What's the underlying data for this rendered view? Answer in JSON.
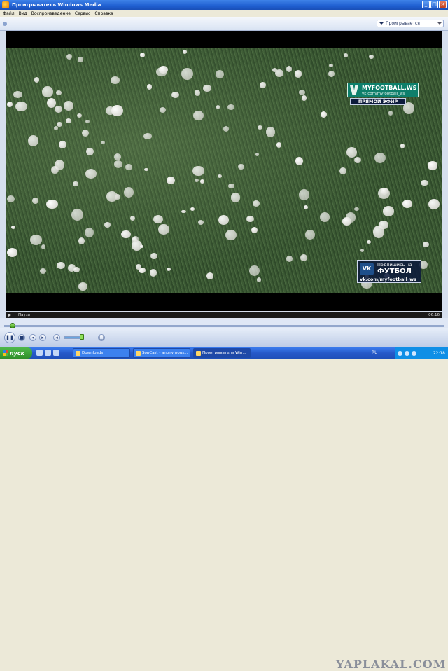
{
  "window": {
    "title": "Проигрыватель Windows Media",
    "controls": {
      "minimize": "_",
      "maximize": "□",
      "close": "×"
    }
  },
  "menu": [
    "Файл",
    "Вид",
    "Воспроизведение",
    "Сервис",
    "Справка"
  ],
  "now_playing": {
    "label": "Проигрывается"
  },
  "overlay": {
    "brand": "MYFOOTBALL.WS",
    "brand_url": "vk.com/myfootball_ws",
    "live_badge": "ПРЯМОЙ ЭФИР",
    "vk_badge": "VK",
    "vk_line1": "Подпишись на",
    "vk_line2": "ФУТБОЛ",
    "vk_line3": "vk.com/myfootball_ws"
  },
  "status": {
    "text": "Пауза",
    "time": "06:16"
  },
  "seek": {
    "progress_percent": 2.5
  },
  "volume": {
    "level_percent": 85
  },
  "watermark": "YAPLAKAL.COM",
  "taskbar": {
    "start_label": "пуск",
    "tasks": [
      {
        "label": "Downloads",
        "active": false
      },
      {
        "label": "SopCast - anonymous...",
        "active": false
      },
      {
        "label": "Проигрыватель Win...",
        "active": true
      }
    ],
    "lang": "RU",
    "clock": "22:18"
  },
  "colors": {
    "titlebar": "#1f5fd1",
    "taskbar": "#2659c9",
    "start": "#2f8f2a",
    "brand": "#0e7f6b"
  }
}
